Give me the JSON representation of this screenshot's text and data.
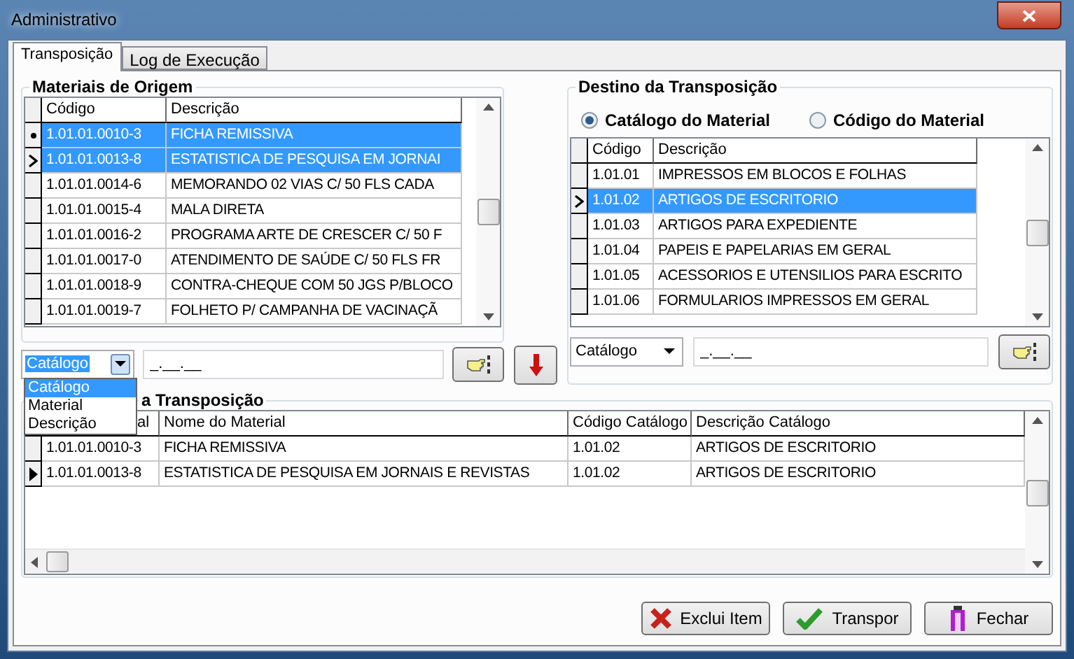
{
  "window": {
    "title": "Administrativo"
  },
  "tabs": [
    {
      "label": "Transposição",
      "selected": true
    },
    {
      "label": "Log de Execução",
      "selected": false
    }
  ],
  "origin": {
    "title": "Materiais de Origem",
    "columns": [
      "Código",
      "Descrição"
    ],
    "rows": [
      {
        "cells": [
          "1.01.01.0010-3",
          "FICHA REMISSIVA"
        ],
        "selected": true,
        "kind": "dot"
      },
      {
        "cells": [
          "1.01.01.0013-8",
          "ESTATISTICA DE PESQUISA EM JORNAI"
        ],
        "selected": true,
        "kind": "caret"
      },
      {
        "cells": [
          "1.01.01.0014-6",
          "MEMORANDO 02 VIAS C/ 50 FLS CADA"
        ],
        "selected": false,
        "kind": "plain"
      },
      {
        "cells": [
          "1.01.01.0015-4",
          "MALA DIRETA"
        ],
        "selected": false,
        "kind": "plain"
      },
      {
        "cells": [
          "1.01.01.0016-2",
          "PROGRAMA ARTE DE CRESCER C/ 50 F"
        ],
        "selected": false,
        "kind": "plain"
      },
      {
        "cells": [
          "1.01.01.0017-0",
          "ATENDIMENTO DE SAÚDE C/ 50 FLS FR"
        ],
        "selected": false,
        "kind": "plain"
      },
      {
        "cells": [
          "1.01.01.0018-9",
          "CONTRA-CHEQUE COM 50 JGS P/BLOCO"
        ],
        "selected": false,
        "kind": "plain"
      },
      {
        "cells": [
          "1.01.01.0019-7",
          "FOLHETO P/ CAMPANHA DE VACINAÇÃ"
        ],
        "selected": false,
        "kind": "plain"
      }
    ],
    "combo": {
      "value": "Catálogo",
      "focused": true,
      "expanded": true,
      "options": [
        {
          "label": "Catálogo",
          "selected": true
        },
        {
          "label": "Material",
          "selected": false
        },
        {
          "label": "Descrição",
          "selected": false
        }
      ]
    },
    "mask": "_.__.__"
  },
  "destination": {
    "title": "Destino da Transposição",
    "radios": [
      {
        "label": "Catálogo do Material",
        "selected": true
      },
      {
        "label": "Código do Material",
        "selected": false
      }
    ],
    "columns": [
      "Código",
      "Descrição"
    ],
    "rows": [
      {
        "cells": [
          "1.01.01",
          "IMPRESSOS EM BLOCOS E FOLHAS"
        ],
        "selected": false,
        "kind": "plain"
      },
      {
        "cells": [
          "1.01.02",
          "ARTIGOS DE ESCRITORIO"
        ],
        "selected": true,
        "kind": "caret"
      },
      {
        "cells": [
          "1.01.03",
          "ARTIGOS PARA EXPEDIENTE"
        ],
        "selected": false,
        "kind": "plain"
      },
      {
        "cells": [
          "1.01.04",
          "PAPEIS E PAPELARIAS EM GERAL"
        ],
        "selected": false,
        "kind": "plain"
      },
      {
        "cells": [
          "1.01.05",
          "ACESSORIOS E UTENSILIOS PARA ESCRITO"
        ],
        "selected": false,
        "kind": "plain"
      },
      {
        "cells": [
          "1.01.06",
          "FORMULARIOS IMPRESSOS EM GERAL"
        ],
        "selected": false,
        "kind": "plain"
      }
    ],
    "combo": {
      "value": "Catálogo",
      "focused": false,
      "expanded": false
    },
    "mask": "_.__.__"
  },
  "result": {
    "title": "a Transposição",
    "columns": [
      "al",
      "Nome do Material",
      "Código Catálogo",
      "Descrição Catálogo"
    ],
    "rows": [
      {
        "cells": [
          "1.01.01.0010-3",
          "FICHA REMISSIVA",
          "1.01.02",
          "ARTIGOS DE ESCRITORIO"
        ],
        "selected": false,
        "kind": "plain"
      },
      {
        "cells": [
          "1.01.01.0013-8",
          "ESTATISTICA DE PESQUISA EM JORNAIS E REVISTAS",
          "1.01.02",
          "ARTIGOS DE ESCRITORIO"
        ],
        "selected": false,
        "kind": "arrow"
      }
    ]
  },
  "buttons": [
    {
      "label": "Exclui Item",
      "kind": "delete"
    },
    {
      "label": "Transpor",
      "kind": "confirm"
    },
    {
      "label": "Fechar",
      "kind": "close"
    }
  ]
}
